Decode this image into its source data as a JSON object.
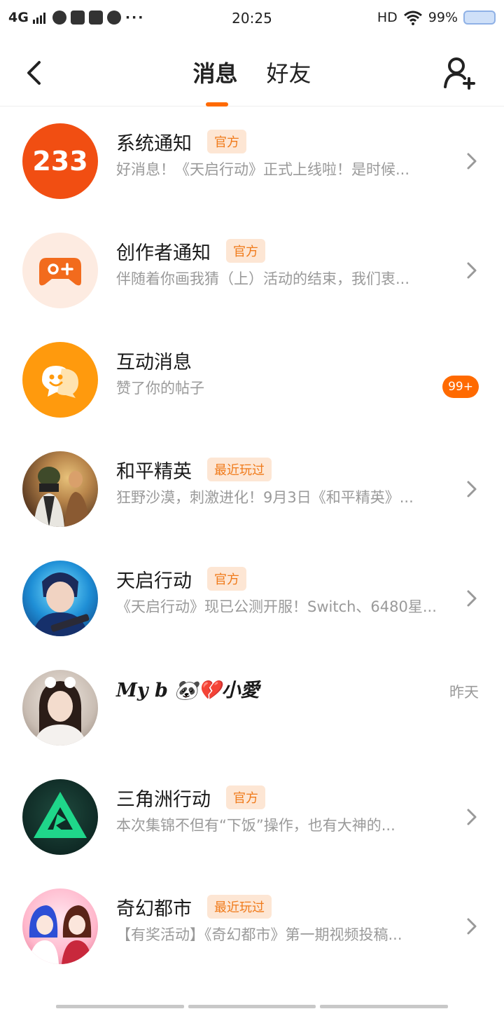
{
  "status_bar": {
    "network": "4G",
    "time": "20:25",
    "hd": "HD",
    "battery": "99%"
  },
  "header": {
    "tabs": [
      {
        "label": "消息",
        "active": true
      },
      {
        "label": "好友",
        "active": false
      }
    ],
    "accent_color": "#ff6a00"
  },
  "messages": [
    {
      "name": "系统通知",
      "tag": "官方",
      "preview": "好消息！《天启行动》正式上线啦！是时候...",
      "avatar": "233-logo-icon",
      "avatar_text": "233",
      "trailing": "chevron"
    },
    {
      "name": "创作者通知",
      "tag": "官方",
      "preview": "伴随着你画我猜（上）活动的结束，我们衷...",
      "avatar": "gamepad-icon",
      "trailing": "chevron"
    },
    {
      "name": "互动消息",
      "tag": "",
      "preview": "赞了你的帖子",
      "avatar": "chat-bubble-icon",
      "trailing": "badge",
      "badge": "99+"
    },
    {
      "name": "和平精英",
      "tag": "最近玩过",
      "preview": "狂野沙漠，刺激进化！9月3日《和平精英》...",
      "avatar": "game-avatar-heping",
      "trailing": "chevron"
    },
    {
      "name": "天启行动",
      "tag": "官方",
      "preview": "《天启行动》现已公测开服！Switch、6480星...",
      "avatar": "game-avatar-tianqi",
      "trailing": "chevron"
    },
    {
      "name": "My b 🐼💔小愛",
      "tag": "",
      "preview": "",
      "avatar": "user-avatar-photo",
      "trailing": "time",
      "time": "昨天"
    },
    {
      "name": "三角洲行动",
      "tag": "官方",
      "preview": "本次集锦不但有“下饭”操作，也有大神的...",
      "avatar": "game-avatar-delta",
      "trailing": "chevron"
    },
    {
      "name": "奇幻都市",
      "tag": "最近玩过",
      "preview": "【有奖活动】《奇幻都市》第一期视频投稿...",
      "avatar": "game-avatar-qihuan",
      "trailing": "chevron"
    }
  ]
}
